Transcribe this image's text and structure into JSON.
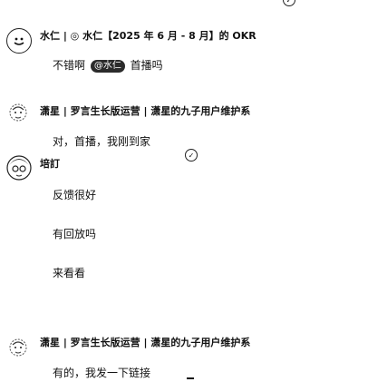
{
  "messages": [
    {
      "sender": "水仁 | ◎ 水仁【2025 年 6 月 - 8 月】的 OKR",
      "text_before": "不错啊",
      "mention": "@水仁",
      "text_after": "首播吗"
    },
    {
      "sender": "潇星 | 罗言生长版运营 | 潇星的九子用户维护系",
      "text": "对，首播，我刚到家"
    },
    {
      "sender": "培訂",
      "lines": [
        "反馈很好",
        "有回放吗",
        "来看看"
      ]
    },
    {
      "sender": "潇星 | 罗言生长版运营 | 潇星的九子用户维护系",
      "text": "有的，我发一下链接"
    }
  ],
  "icons": [
    "check-circle-icon",
    "cursor-icon"
  ]
}
